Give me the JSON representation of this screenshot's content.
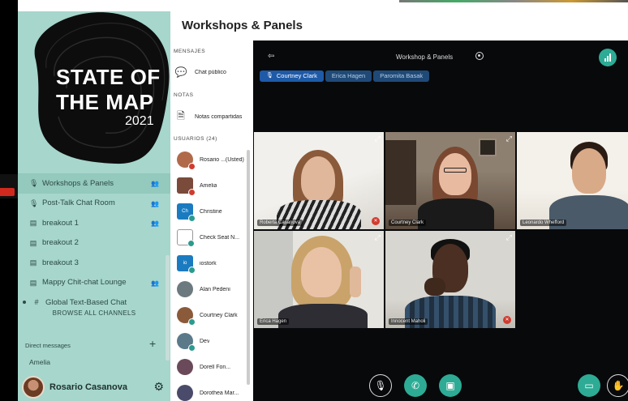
{
  "heading": "Workshops & Panels",
  "logo": {
    "title_line1": "STATE OF",
    "title_line2": "THE MAP",
    "year": "2021"
  },
  "channels": [
    {
      "label": "Workshops & Panels",
      "icon": "mic-icon",
      "group": true,
      "active": true
    },
    {
      "label": "Post-Talk Chat Room",
      "icon": "mic-icon",
      "group": true
    },
    {
      "label": "breakout 1",
      "icon": "speaker-icon",
      "group": true
    },
    {
      "label": "breakout 2",
      "icon": "speaker-icon",
      "group": false
    },
    {
      "label": "breakout 3",
      "icon": "speaker-icon",
      "group": false
    },
    {
      "label": "Mappy Chit-chat Lounge",
      "icon": "speaker-icon",
      "group": true
    },
    {
      "label": "Global Text-Based Chat",
      "icon": "hash-icon",
      "group": false,
      "global": true
    }
  ],
  "browse_label": "BROWSE ALL CHANNELS",
  "dm": {
    "title": "Direct messages",
    "plus": "+",
    "items": [
      "Amelia"
    ]
  },
  "me": {
    "name": "Rosario Casanova"
  },
  "panel": {
    "messages_header": "MENSAJES",
    "public_chat": "Chat público",
    "notes_header": "NOTAS",
    "shared_notes": "Notas compartidas",
    "users_header": "USUARIOS (24)",
    "users": [
      {
        "name": "Rosario ...(Usted)",
        "color": "#b06a4a",
        "badge": "b-red",
        "square": false
      },
      {
        "name": "Amelia",
        "color": "#7a4a3a",
        "badge": "b-red",
        "square": true
      },
      {
        "name": "Christine",
        "color": "#1b7bc0",
        "badge": "b-teal",
        "square": true,
        "initials": "Ch"
      },
      {
        "name": "Check Seat N...",
        "color": "#ffffff",
        "badge": "b-teal",
        "square": true,
        "initials": ""
      },
      {
        "name": "iostork",
        "color": "#1b7bc0",
        "badge": "b-teal",
        "square": true,
        "initials": "io"
      },
      {
        "name": "Alan Pedeni",
        "color": "#6c7a80",
        "badge": "",
        "square": false
      },
      {
        "name": "Courtney Clark",
        "color": "#8a5a3a",
        "badge": "b-teal",
        "square": false
      },
      {
        "name": "Dev",
        "color": "#5a7a8a",
        "badge": "b-teal",
        "square": false
      },
      {
        "name": "Dorell Fon...",
        "color": "#6a4a5a",
        "badge": "",
        "square": false
      },
      {
        "name": "Dorothea Mar...",
        "color": "#4a4a6a",
        "badge": "",
        "square": false
      }
    ]
  },
  "stage": {
    "title": "Workshop & Panels",
    "talkers": [
      {
        "name": "Courtney Clark",
        "active": true
      },
      {
        "name": "Erica Hagen",
        "active": false
      },
      {
        "name": "Paromita Basak",
        "active": false
      }
    ],
    "tiles": [
      {
        "label": "Roberta Casanova",
        "muted": true
      },
      {
        "label": "Courtney Clark",
        "muted": false
      },
      {
        "label": "Leonardo Whefford",
        "muted": false
      },
      {
        "label": "Erica Hagen",
        "muted": false
      },
      {
        "label": "Innocent Maholi",
        "muted": true
      }
    ]
  },
  "colors": {
    "sidebar": "#a6d6cc",
    "accent": "#2dab95",
    "talker": "#1e5aa8",
    "mute": "#d13b2e"
  }
}
